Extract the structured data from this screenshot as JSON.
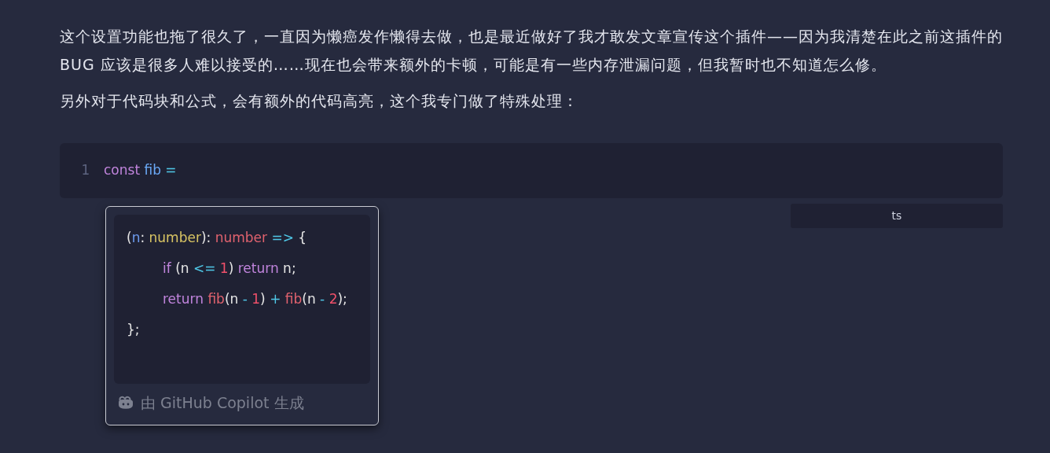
{
  "paragraphs": [
    "这个设置功能也拖了很久了，一直因为懒癌发作懒得去做，也是最近做好了我才敢发文章宣传这个插件——因为我清楚在此之前这插件的 BUG 应该是很多人难以接受的……现在也会带来额外的卡顿，可能是有一些内存泄漏问题，但我暂时也不知道怎么修。",
    "另外对于代码块和公式，会有额外的代码高亮，这个我专门做了特殊处理："
  ],
  "code_block": {
    "line_number": "1",
    "tokens": [
      {
        "text": "const ",
        "kind": "keyword"
      },
      {
        "text": "fib ",
        "kind": "variable"
      },
      {
        "text": "=",
        "kind": "operator"
      }
    ],
    "language": "ts"
  },
  "suggestion": {
    "lines": [
      {
        "tokens": [
          {
            "text": "(",
            "kind": "plain"
          },
          {
            "text": "n",
            "kind": "param"
          },
          {
            "text": ": ",
            "kind": "plain"
          },
          {
            "text": "number",
            "kind": "type"
          },
          {
            "text": "): ",
            "kind": "plain"
          },
          {
            "text": "number ",
            "kind": "function"
          },
          {
            "text": "=> ",
            "kind": "operator"
          },
          {
            "text": "{",
            "kind": "plain"
          }
        ],
        "children": [
          {
            "tokens": [
              {
                "text": "if ",
                "kind": "keyword"
              },
              {
                "text": "(n ",
                "kind": "plain"
              },
              {
                "text": "<= ",
                "kind": "operator"
              },
              {
                "text": "1",
                "kind": "number"
              },
              {
                "text": ") ",
                "kind": "plain"
              },
              {
                "text": "return ",
                "kind": "keyword"
              },
              {
                "text": "n;",
                "kind": "plain"
              }
            ]
          },
          {
            "tokens": [
              {
                "text": "return ",
                "kind": "keyword"
              },
              {
                "text": "fib",
                "kind": "function"
              },
              {
                "text": "(n ",
                "kind": "plain"
              },
              {
                "text": "- ",
                "kind": "operator"
              },
              {
                "text": "1",
                "kind": "number"
              },
              {
                "text": ") ",
                "kind": "plain"
              },
              {
                "text": "+ ",
                "kind": "operator"
              },
              {
                "text": "fib",
                "kind": "function"
              },
              {
                "text": "(n ",
                "kind": "plain"
              },
              {
                "text": "- ",
                "kind": "operator"
              },
              {
                "text": "2",
                "kind": "number"
              },
              {
                "text": ");",
                "kind": "plain"
              }
            ]
          }
        ]
      },
      {
        "tokens": [
          {
            "text": "};",
            "kind": "plain"
          }
        ]
      }
    ],
    "footer": "由 GitHub Copilot 生成"
  }
}
